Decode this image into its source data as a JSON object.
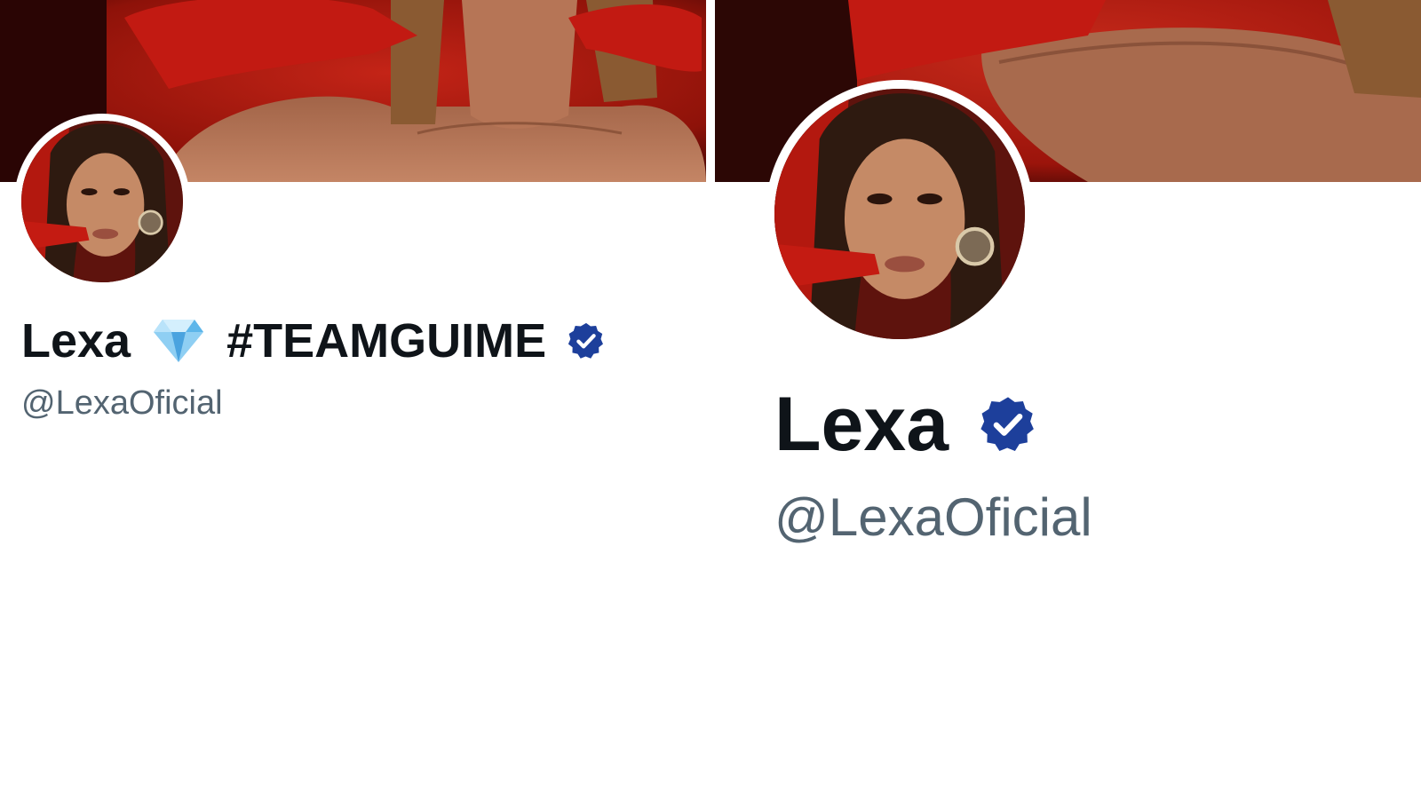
{
  "left_profile": {
    "display_name": "Lexa",
    "name_emoji": "gem-stone-emoji",
    "hashtag": "#TEAMGUIME",
    "handle": "@LexaOficial",
    "verified": true
  },
  "right_profile": {
    "display_name": "Lexa",
    "handle": "@LexaOficial",
    "verified": true
  },
  "colors": {
    "verified_badge": "#1d3f9b",
    "name_text": "#0f1419",
    "handle_text": "#536471",
    "banner_red": "#b3180f"
  },
  "icons": {
    "verified": "verified-badge-icon",
    "gem": "gem-stone-icon"
  }
}
